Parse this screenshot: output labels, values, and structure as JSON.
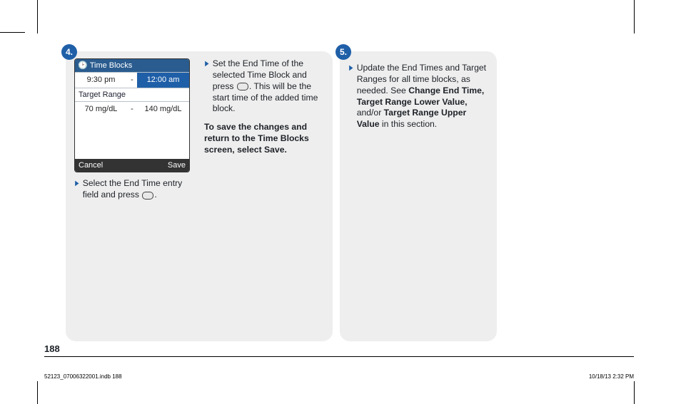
{
  "step4": {
    "badge": "4.",
    "device": {
      "title_prefix": "Time Blocks",
      "time_left": "9:30 pm",
      "time_sep": "-",
      "time_right": "12:00 am",
      "range_label": "Target Range",
      "range_left": "70 mg/dL",
      "range_sep": "-",
      "range_right": "140 mg/dL",
      "btn_cancel": "Cancel",
      "btn_save": "Save"
    },
    "bullet1": "Select the End Time entry field and press",
    "bullet1_end": ".",
    "bullet2_a": "Set the End Time of the selected Time Block and press",
    "bullet2_b": ". This will be the start time of the added time block.",
    "save_note": "To save the changes and return to the Time Blocks screen, select Save."
  },
  "step5": {
    "badge": "5.",
    "text_a": "Update the End Times and Target Ranges for all time blocks, as needed. See ",
    "text_b": "Change End Time, Target Range Lower Value,",
    "text_c": " and/or ",
    "text_d": "Target Range Upper Value",
    "text_e": " in this section."
  },
  "page_number": "188",
  "footer_left": "52123_07006322001.indb   188",
  "footer_right": "10/18/13   2:32 PM"
}
